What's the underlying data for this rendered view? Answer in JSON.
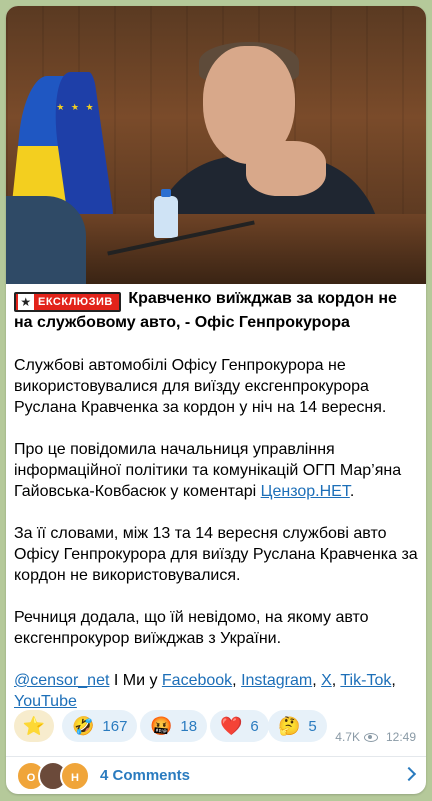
{
  "post": {
    "badge_label": "ЕКСКЛЮЗИВ",
    "headline": "Кравченко виїжджав за кордон не на службовому авто, - Офіс Генпрокурора",
    "paragraphs": {
      "p1": "Службові автомобілі Офісу Генпрокурора не використовувалися для виїзду ексгенпрокурора Руслана Кравченка за кордон у ніч на 14 вересня.",
      "p2_before": "Про це повідомила начальниця управління інформаційної політики та комунікацій ОГП Мар’яна Гайовська-Ковбасюк у коментарі ",
      "p2_link": "Цензор.НЕТ",
      "p2_after": ".",
      "p3": "За її словами, між 13 та 14 вересня службові авто Офісу Генпрокурора для виїзду Руслана Кравченка за кордон не використовувалися.",
      "p4": "Речниця додала, що їй невідомо, на якому авто ексгенпрокурор виїжджав з України."
    },
    "footer_links": {
      "handle": "@censor_net",
      "sep1": " І Ми у ",
      "facebook": "Facebook",
      "comma": ", ",
      "instagram": "Instagram",
      "x": "X",
      "tiktok": "Tik-Tok",
      "youtube": "YouTube"
    }
  },
  "reactions": [
    {
      "emoji": "⭐",
      "count": ""
    },
    {
      "emoji": "🤣",
      "count": "167"
    },
    {
      "emoji": "🤬",
      "count": "18"
    },
    {
      "emoji": "❤️",
      "count": "6"
    },
    {
      "emoji": "🤔",
      "count": "5"
    }
  ],
  "meta": {
    "views": "4.7K",
    "time": "12:49"
  },
  "comments": {
    "label": "4 Comments",
    "avatars": [
      "О",
      "",
      "Н"
    ]
  },
  "colors": {
    "background": "#b5c99a",
    "link": "#1d6fb8",
    "accent": "#2a7bbf",
    "badge": "#e2231a"
  }
}
